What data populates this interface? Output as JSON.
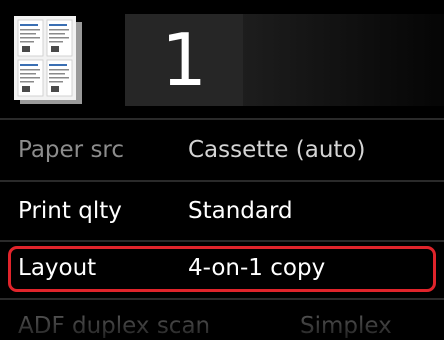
{
  "header": {
    "layout_icon": "four-on-one-layout-icon",
    "copies": "1"
  },
  "settings": [
    {
      "label": "Paper src",
      "value": "Cassette (auto)"
    },
    {
      "label": "Print qlty",
      "value": "Standard"
    },
    {
      "label": "Layout",
      "value": "4-on-1 copy"
    },
    {
      "label": "ADF duplex scan",
      "value": "Simplex"
    }
  ],
  "colors": {
    "highlight": "#e0242b",
    "background": "#000000"
  }
}
